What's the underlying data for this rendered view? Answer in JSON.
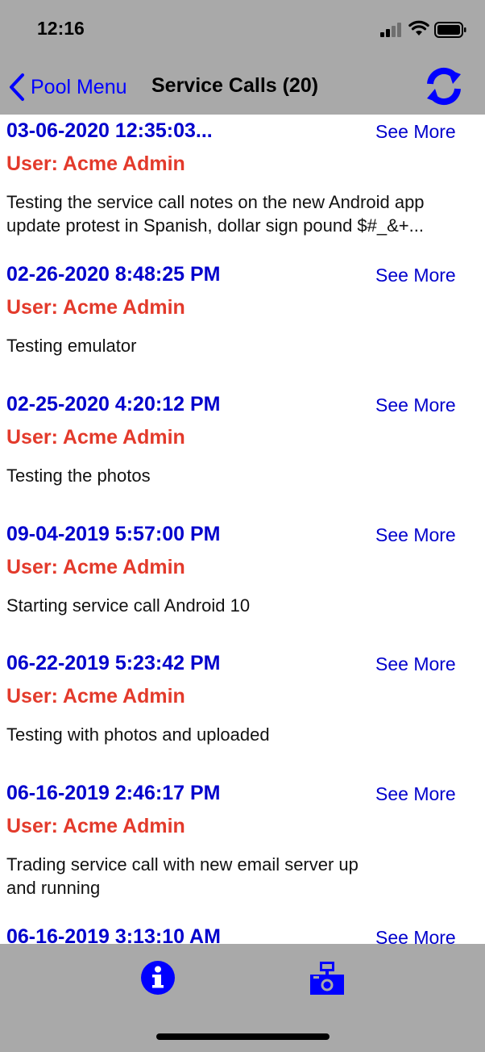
{
  "status_bar": {
    "time": "12:16",
    "icons": [
      "signal-icon",
      "wifi-icon",
      "battery-icon"
    ]
  },
  "nav": {
    "back_label": "Pool Menu",
    "title": "Service Calls (20)",
    "refresh_icon": "refresh-icon"
  },
  "colors": {
    "bar_gray": "#a9a9a9",
    "link_blue": "#0000cc",
    "user_red": "#e33a2b"
  },
  "calls": [
    {
      "date": "03-06-2020 12:35:03...",
      "user": "User: Acme Admin",
      "see_more": "See More",
      "notes_lines": [
        "Testing the service call notes on the new Android app",
        "update protest in Spanish, dollar sign pound $#_&+..."
      ]
    },
    {
      "date": "02-26-2020 8:48:25 PM",
      "user": "User: Acme Admin",
      "see_more": "See More",
      "notes_lines": [
        "Testing emulator"
      ]
    },
    {
      "date": "02-25-2020 4:20:12 PM",
      "user": "User: Acme Admin",
      "see_more": "See More",
      "notes_lines": [
        "Testing the photos"
      ]
    },
    {
      "date": "09-04-2019 5:57:00 PM",
      "user": "User: Acme Admin",
      "see_more": "See More",
      "notes_lines": [
        "Starting service call Android 10"
      ]
    },
    {
      "date": "06-22-2019 5:23:42 PM",
      "user": "User: Acme Admin",
      "see_more": "See More",
      "notes_lines": [
        "Testing with photos and uploaded"
      ]
    },
    {
      "date": "06-16-2019 2:46:17 PM",
      "user": "User: Acme Admin",
      "see_more": "See More",
      "notes_lines": [
        "Trading service call with new email server up",
        "and running"
      ]
    },
    {
      "date": "06-16-2019 3:13:10 AM",
      "user": "",
      "see_more": "See More",
      "notes_lines": []
    }
  ],
  "tab_bar": {
    "items": [
      "info-icon",
      "camera-icon"
    ]
  }
}
